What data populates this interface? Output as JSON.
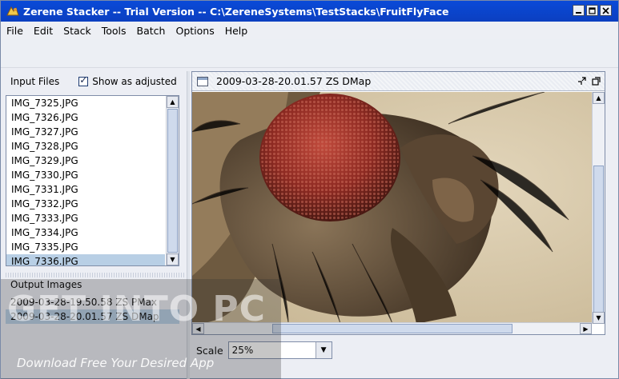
{
  "window": {
    "title": "Zerene Stacker -- Trial Version -- C:\\ZereneSystems\\TestStacks\\FruitFlyFace"
  },
  "menu": [
    "File",
    "Edit",
    "Stack",
    "Tools",
    "Batch",
    "Options",
    "Help"
  ],
  "input_files": {
    "label": "Input Files",
    "show_adjusted_label": "Show as adjusted",
    "show_adjusted_checked": true,
    "files": [
      "IMG_7325.JPG",
      "IMG_7326.JPG",
      "IMG_7327.JPG",
      "IMG_7328.JPG",
      "IMG_7329.JPG",
      "IMG_7330.JPG",
      "IMG_7331.JPG",
      "IMG_7332.JPG",
      "IMG_7333.JPG",
      "IMG_7334.JPG",
      "IMG_7335.JPG",
      "IMG_7336.JPG"
    ],
    "selected_index": 11
  },
  "output_images": {
    "label": "Output Images",
    "items": [
      "2009-03-28-19.50.58 ZS PMax",
      "2009-03-28-20.01.57 ZS DMap"
    ],
    "selected_index": 1
  },
  "viewer": {
    "title": "2009-03-28-20.01.57 ZS DMap",
    "scale_label": "Scale",
    "scale_value": "25%"
  },
  "watermark": {
    "text": "GET INTO PC",
    "subtext": "Download Free Your Desired App"
  },
  "colors": {
    "titlebar": "#0b44d0",
    "selection": "#b8cfe5"
  }
}
